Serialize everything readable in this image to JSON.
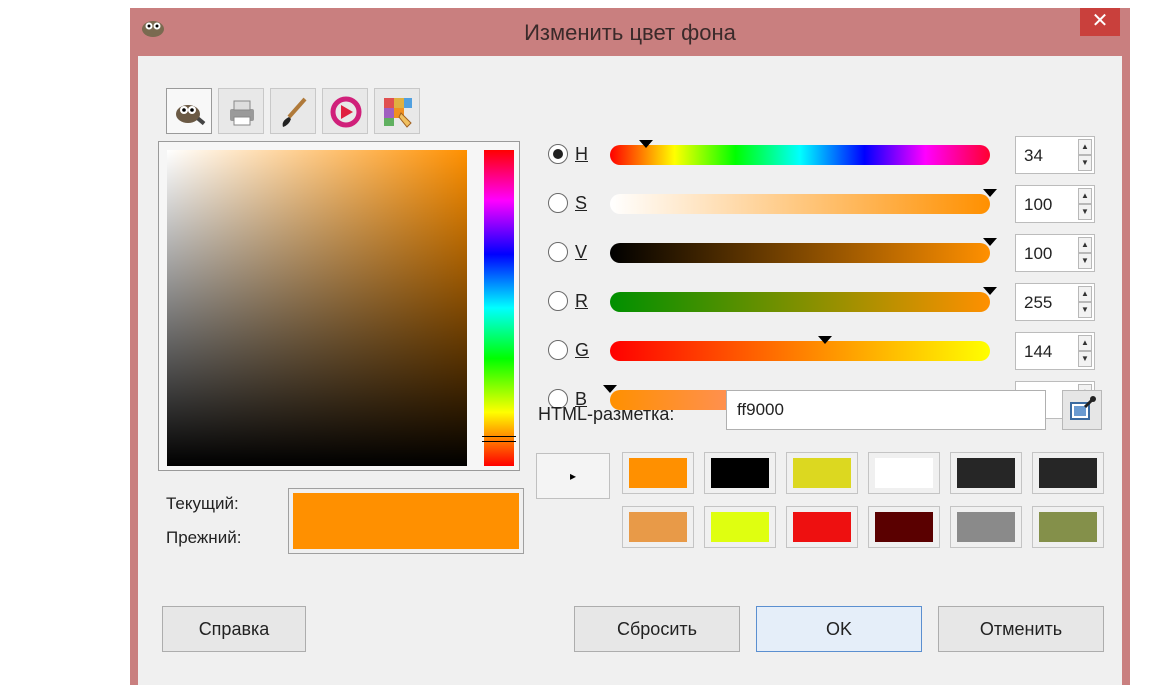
{
  "window": {
    "title": "Изменить цвет фона",
    "close_glyph": "✕"
  },
  "tabs": [
    {
      "name": "gimp-selector-icon",
      "active": true
    },
    {
      "name": "printer-cmyk-icon",
      "active": false
    },
    {
      "name": "paintbrush-icon",
      "active": false
    },
    {
      "name": "color-wheel-icon",
      "active": false
    },
    {
      "name": "palette-icon",
      "active": false
    }
  ],
  "colors": {
    "current": "#ff9000",
    "previous": "#ff9000"
  },
  "labels": {
    "current": "Текущий:",
    "previous": "Прежний:",
    "html": "HTML-разметка:"
  },
  "channels": [
    {
      "key": "H",
      "label": "H",
      "value": "34",
      "selected": true,
      "fraction": 0.094
    },
    {
      "key": "S",
      "label": "S",
      "value": "100",
      "selected": false,
      "fraction": 1.0
    },
    {
      "key": "V",
      "label": "V",
      "value": "100",
      "selected": false,
      "fraction": 1.0
    },
    {
      "key": "R",
      "label": "R",
      "value": "255",
      "selected": false,
      "fraction": 1.0
    },
    {
      "key": "G",
      "label": "G",
      "value": "144",
      "selected": false,
      "fraction": 0.565
    },
    {
      "key": "B",
      "label": "B",
      "value": "0",
      "selected": false,
      "fraction": 0.0
    }
  ],
  "html_notation": {
    "value": "ff9000"
  },
  "history": {
    "expand_glyph": "▸",
    "swatches": [
      "#ff9000",
      "#000000",
      "#dcd820",
      "#ffffff",
      "#262626",
      "#262626",
      "#e89a48",
      "#dfff10",
      "#ee1010",
      "#5a0000",
      "#8a8a8a",
      "#84904a"
    ]
  },
  "buttons": {
    "help": "Справка",
    "reset": "Сбросить",
    "ok": "OK",
    "cancel": "Отменить"
  }
}
